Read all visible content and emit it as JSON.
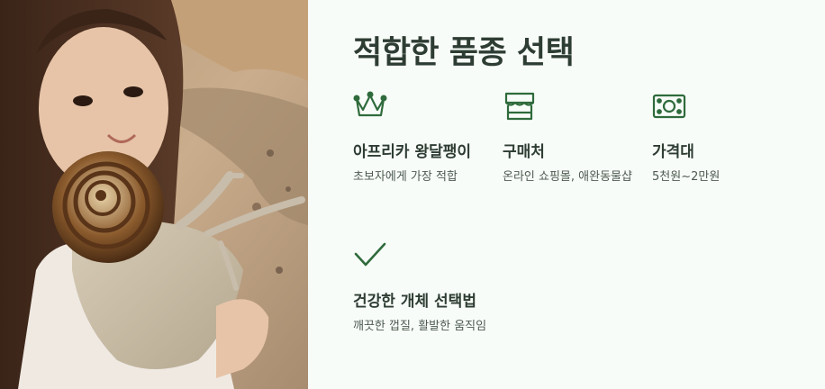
{
  "title": "적합한 품종 선택",
  "accent_color": "#2f6b3c",
  "features": [
    {
      "icon": "crown-icon",
      "title": "아프리카 왕달팽이",
      "desc": "초보자에게 가장 적합"
    },
    {
      "icon": "shop-icon",
      "title": "구매처",
      "desc": "온라인 쇼핑몰, 애완동물샵"
    },
    {
      "icon": "banknote-icon",
      "title": "가격대",
      "desc": "5천원~2만원"
    },
    {
      "icon": "check-icon",
      "title": "건강한 개체 선택법",
      "desc": "깨끗한 껍질, 활발한 움직임"
    }
  ]
}
